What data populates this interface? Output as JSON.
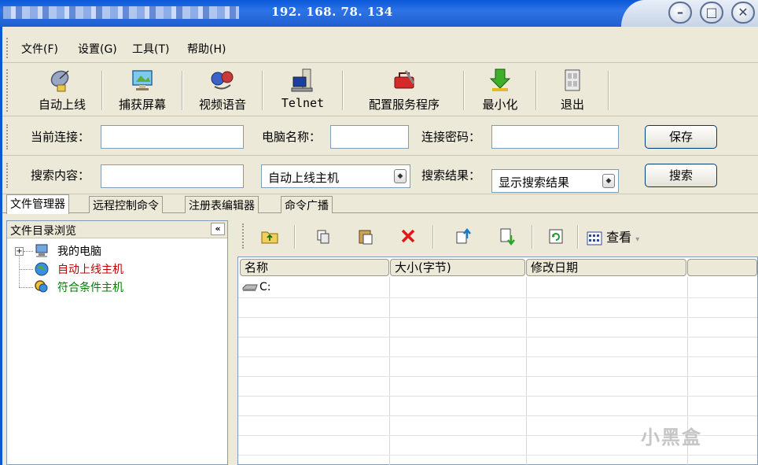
{
  "window": {
    "title": "192. 168. 78. 134"
  },
  "menu": [
    "文件(F)",
    "设置(G)",
    "工具(T)",
    "帮助(H)"
  ],
  "toolbar": [
    {
      "label": "自动上线",
      "icon": "satellite-dish-icon"
    },
    {
      "label": "捕获屏幕",
      "icon": "screen-capture-icon"
    },
    {
      "label": "视频语音",
      "icon": "video-voice-icon"
    },
    {
      "label": "Telnet",
      "icon": "terminal-computer-icon"
    },
    {
      "label": "配置服务程序",
      "icon": "toolbox-icon"
    },
    {
      "label": "最小化",
      "icon": "down-arrow-icon"
    },
    {
      "label": "退出",
      "icon": "exit-icon"
    }
  ],
  "connection": {
    "current_label": "当前连接：",
    "current_value": "",
    "pc_name_label": "电脑名称：",
    "pc_name_value": "",
    "password_label": "连接密码：",
    "password_value": "",
    "save_label": "保存"
  },
  "search": {
    "content_label": "搜索内容：",
    "content_value": "",
    "host_type_value": "自动上线主机",
    "result_label": "搜索结果：",
    "result_value": "显示搜索结果",
    "search_label": "搜索"
  },
  "tabs": [
    "文件管理器",
    "远程控制命令",
    "注册表编辑器",
    "命令广播"
  ],
  "tree": {
    "header": "文件目录浏览",
    "collapse": "«",
    "items": [
      {
        "label": "我的电脑",
        "color": "#000000"
      },
      {
        "label": "自动上线主机",
        "color": "#c00000"
      },
      {
        "label": "符合条件主机",
        "color": "#008000"
      }
    ]
  },
  "file_toolbar": {
    "view_label": "查看"
  },
  "file_list": {
    "columns": [
      "名称",
      "大小(字节)",
      "修改日期",
      ""
    ],
    "rows": [
      {
        "name": "C:",
        "size": "",
        "date": ""
      }
    ]
  },
  "watermark": "小黑盒"
}
